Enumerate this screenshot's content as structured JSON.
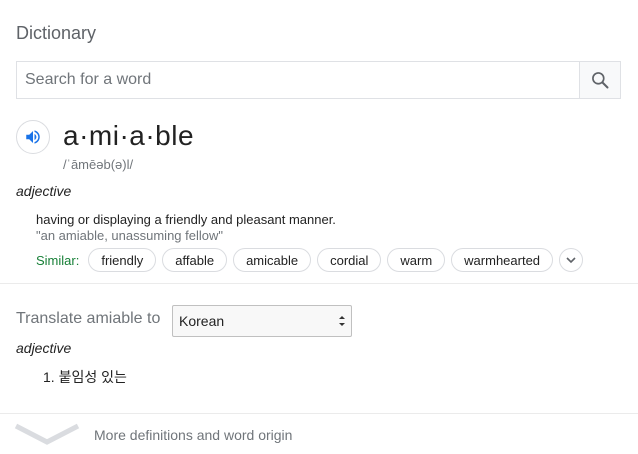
{
  "header": {
    "title": "Dictionary"
  },
  "search": {
    "placeholder": "Search for a word",
    "value": ""
  },
  "entry": {
    "word": "a·mi·a·ble",
    "phonetic": "/ˈāmēəb(ə)l/",
    "part_of_speech": "adjective",
    "definition": "having or displaying a friendly and pleasant manner.",
    "example": "\"an amiable, unassuming fellow\"",
    "similar_label": "Similar:",
    "similar": [
      "friendly",
      "affable",
      "amicable",
      "cordial",
      "warm",
      "warmhearted"
    ]
  },
  "translate": {
    "label": "Translate amiable to",
    "language": "Korean",
    "part_of_speech": "adjective",
    "translations": [
      "1. 붙임성 있는"
    ]
  },
  "footer": {
    "more_label": "More definitions and word origin"
  },
  "colors": {
    "accent": "#1a73e8",
    "similar": "#188038",
    "muted": "#70757a"
  }
}
